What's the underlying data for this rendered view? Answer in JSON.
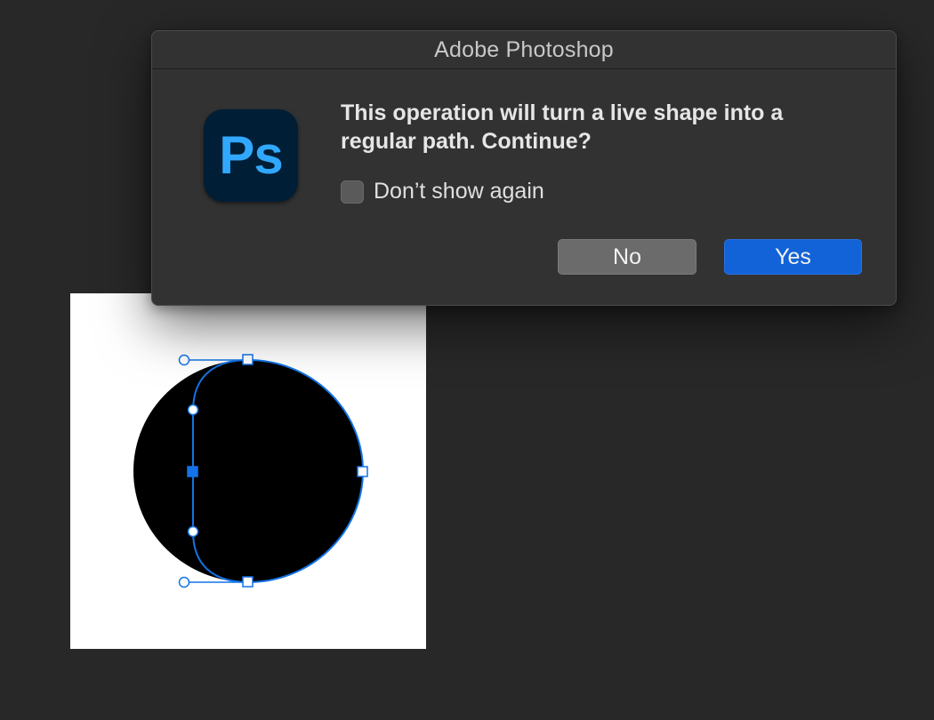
{
  "dialog": {
    "title": "Adobe Photoshop",
    "app_icon_label": "Ps",
    "message_line1": "This operation will turn a live shape into a",
    "message_line2": "regular path. Continue?",
    "checkbox_label": "Don’t show again",
    "checkbox_checked": false,
    "no_label": "No",
    "yes_label": "Yes"
  },
  "canvas": {
    "shape": "ellipse",
    "shape_color": "#000000",
    "path_color": "#1473e6",
    "background_color": "#ffffff"
  },
  "colors": {
    "workspace": "#282828",
    "dialog_bg": "#323232",
    "primary_button": "#1363d8",
    "secondary_button": "#6b6b6b",
    "ps_icon_bg": "#001e36",
    "ps_icon_text": "#31a8ff"
  }
}
